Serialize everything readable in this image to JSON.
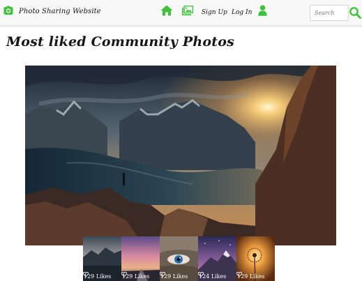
{
  "brand": {
    "name": "Photo Sharing Website",
    "icon": "camera-icon"
  },
  "nav": {
    "home_icon": "home-icon",
    "gallery_icon": "gallery-icon",
    "signup_label": "Sign Up",
    "login_label": "Log In",
    "user_icon": "user-icon",
    "accent_color": "#3fc23a"
  },
  "search": {
    "placeholder": "Search",
    "button_icon": "search-icon"
  },
  "page": {
    "title": "Most liked Community Photos"
  },
  "thumbnails": [
    {
      "subject": "mountain lake at dusk",
      "likes_text": "129 Likes"
    },
    {
      "subject": "road under pink sky",
      "likes_text": "129 Likes"
    },
    {
      "subject": "eye behind scarf",
      "likes_text": "129 Likes"
    },
    {
      "subject": "snowy peak under night sky",
      "likes_text": "124 Likes"
    },
    {
      "subject": "dandelion at sunset",
      "likes_text": "129 Likes"
    }
  ]
}
